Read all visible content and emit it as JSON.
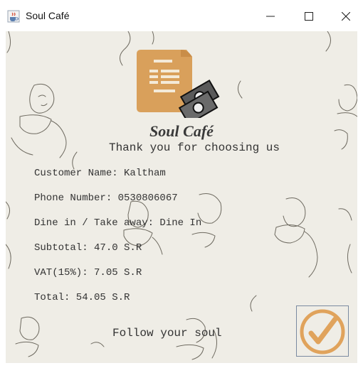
{
  "window": {
    "title": "Soul Café"
  },
  "receipt": {
    "brand": "Soul Café",
    "thanks": "Thank you for choosing us",
    "customer_name": "Customer Name: Kaltham",
    "phone_number": "Phone Number: 0530806067",
    "dine_option": "Dine in / Take away: Dine In",
    "subtotal": "Subtotal: 47.0 S.R",
    "vat": "VAT(15%): 7.05 S.R",
    "total": "Total: 54.05 S.R",
    "footer": "Follow your soul"
  },
  "icons": {
    "app": "java-cup-icon",
    "logo": "receipt-money-icon",
    "confirm": "checkmark-icon"
  },
  "colors": {
    "background": "#efede6",
    "logo_orange": "#d9a05b",
    "check_orange": "#e0a35c"
  }
}
